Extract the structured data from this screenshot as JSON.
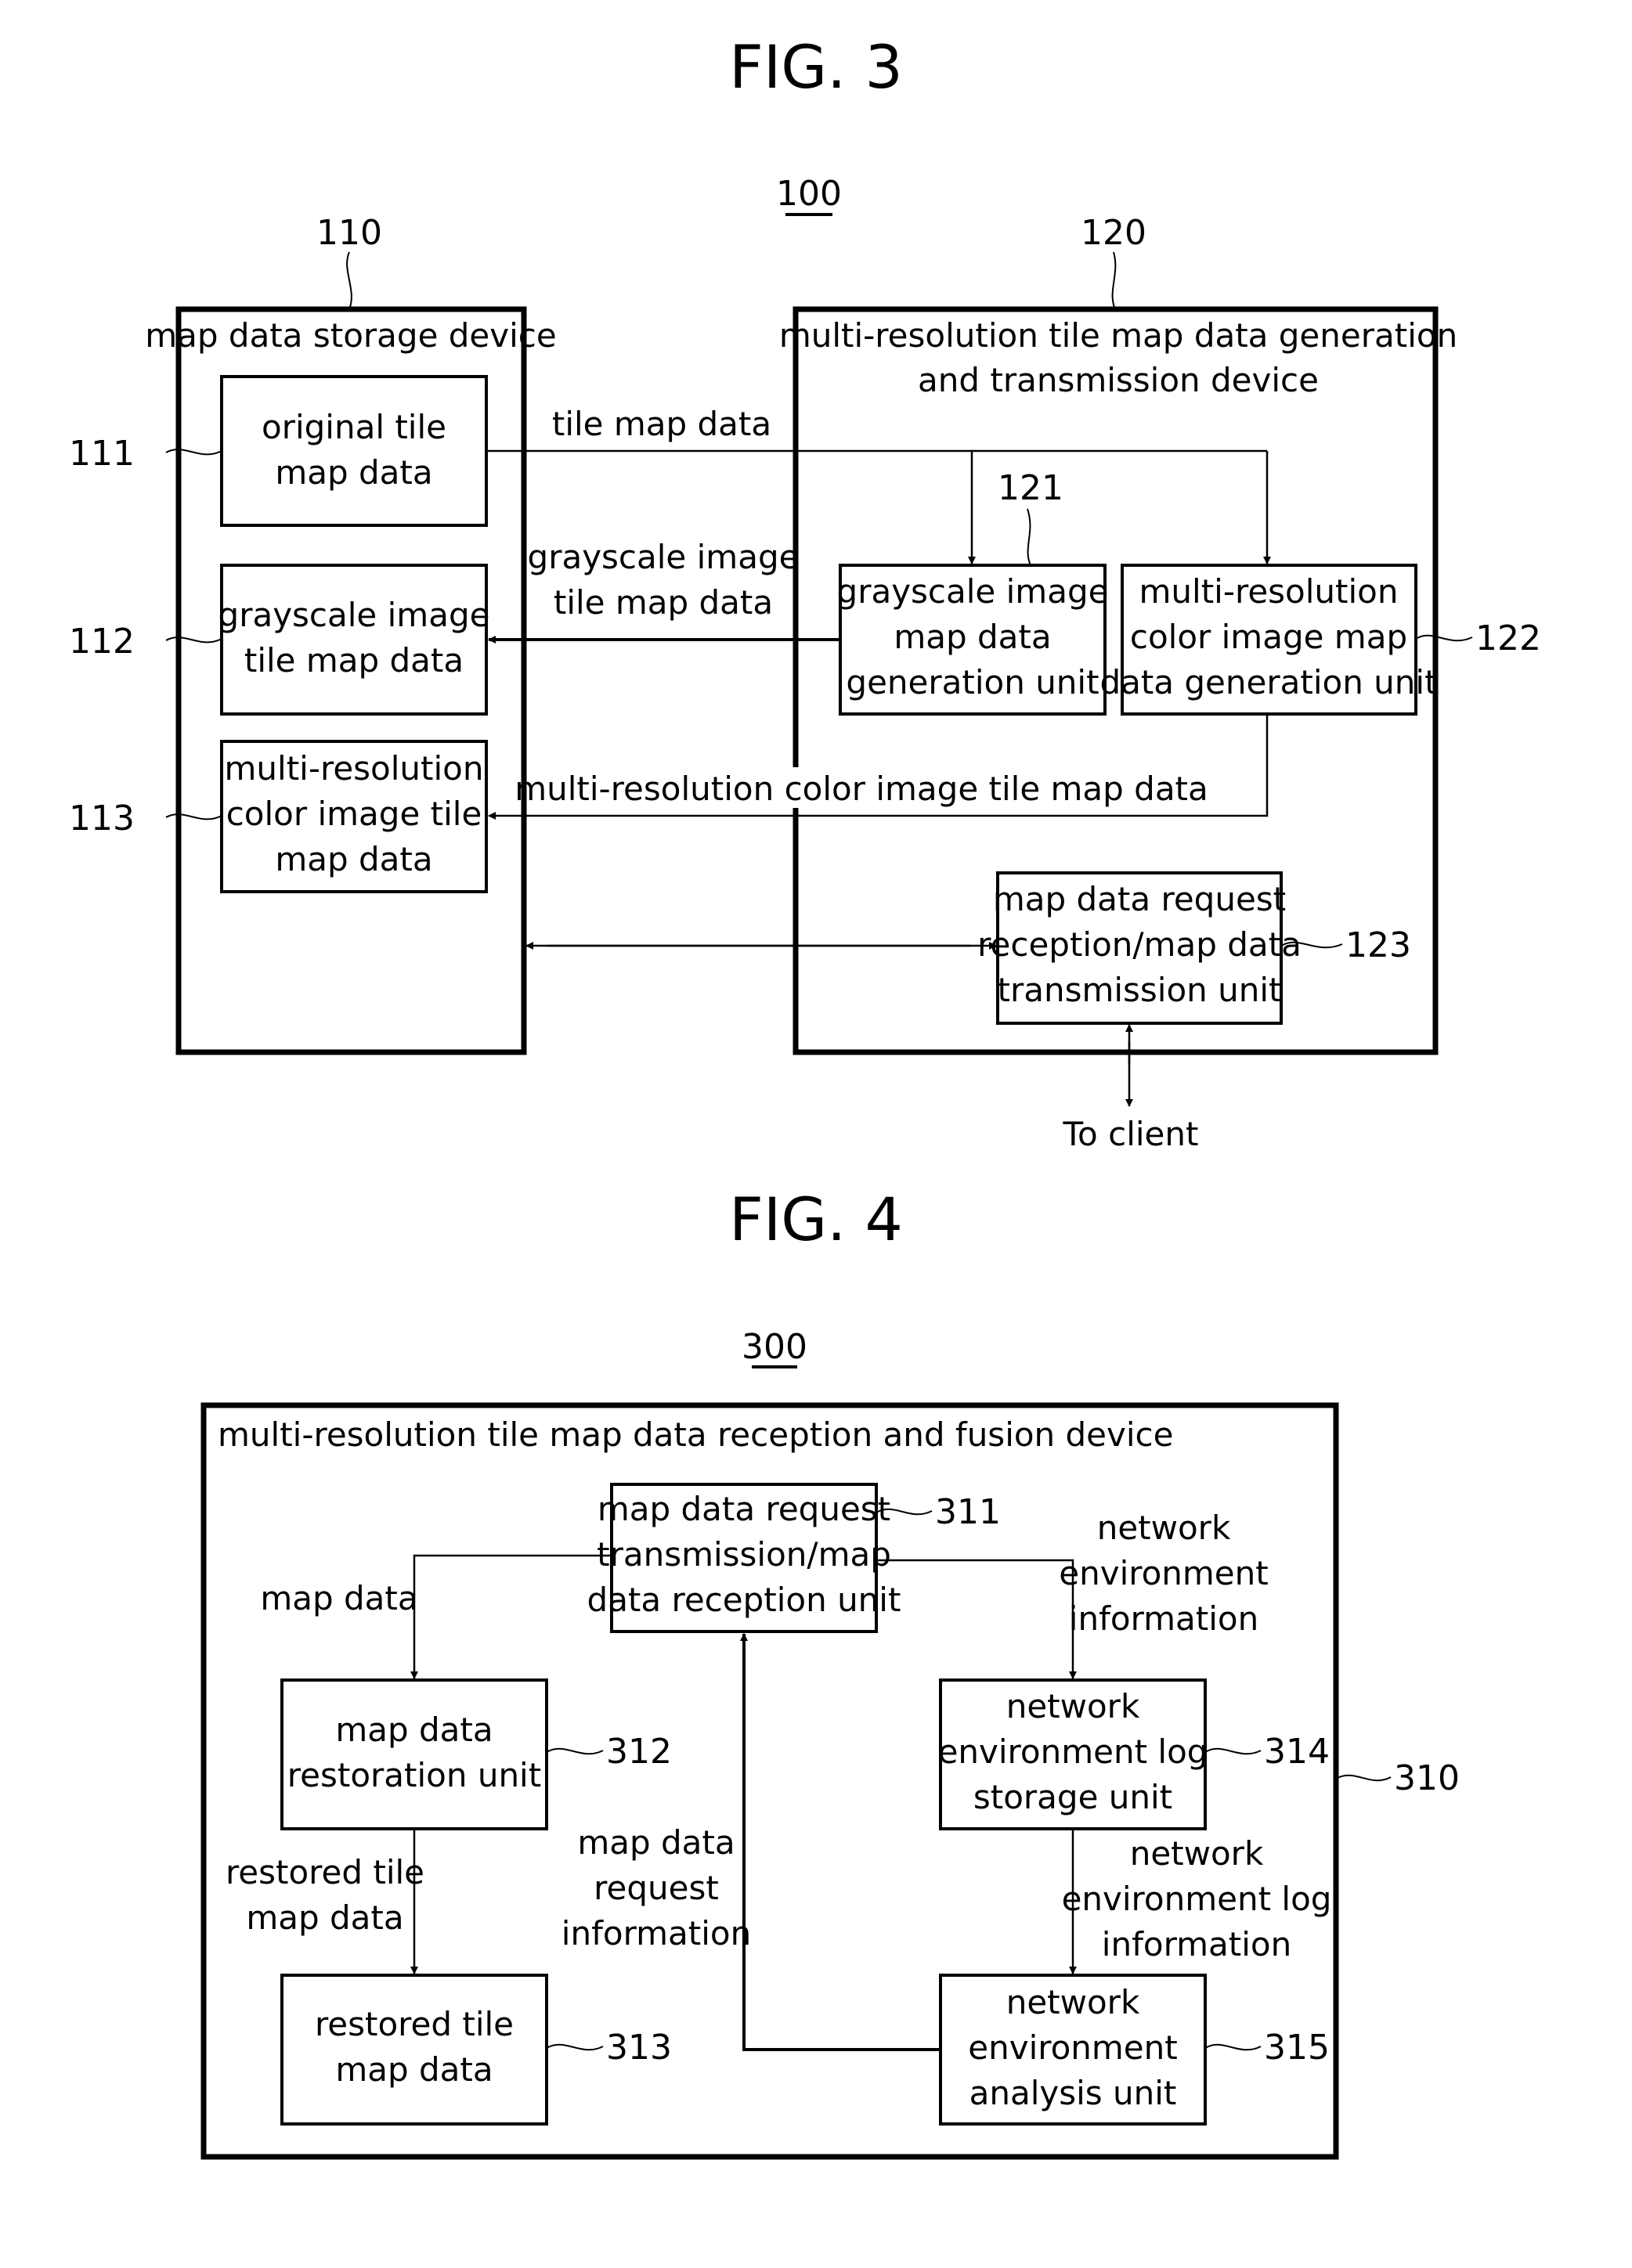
{
  "fig3": {
    "title": "FIG. 3",
    "system_ref": "100",
    "storage_device": {
      "ref": "110",
      "label": "map data storage device",
      "items": [
        {
          "ref": "111",
          "lines": [
            "original tile",
            "map data"
          ]
        },
        {
          "ref": "112",
          "lines": [
            "grayscale image",
            "tile map data"
          ]
        },
        {
          "ref": "113",
          "lines": [
            "multi-resolution",
            "color image tile",
            "map data"
          ]
        }
      ]
    },
    "generation_device": {
      "ref": "120",
      "label_lines": [
        "multi-resolution tile map data generation",
        "and transmission device"
      ],
      "units": [
        {
          "ref": "121",
          "lines": [
            "grayscale image",
            "map data",
            "generation unit"
          ]
        },
        {
          "ref": "122",
          "lines": [
            "multi-resolution",
            "color image map",
            "data generation unit"
          ]
        },
        {
          "ref": "123",
          "lines": [
            "map data request",
            "reception/map data",
            "transmission unit"
          ]
        }
      ]
    },
    "flows": {
      "tile_map_data": "tile map data",
      "grayscale_lines": [
        "grayscale image",
        "tile map data"
      ],
      "multires": "multi-resolution color image tile map data",
      "to_client": "To client"
    }
  },
  "fig4": {
    "title": "FIG. 4",
    "system_ref": "300",
    "device": {
      "ref": "310",
      "label": "multi-resolution tile map data reception and fusion device",
      "units": [
        {
          "ref": "311",
          "lines": [
            "map data request",
            "transmission/map",
            "data reception unit"
          ]
        },
        {
          "ref": "312",
          "lines": [
            "map data",
            "restoration unit"
          ]
        },
        {
          "ref": "313",
          "lines": [
            "restored tile",
            "map data"
          ]
        },
        {
          "ref": "314",
          "lines": [
            "network",
            "environment log",
            "storage unit"
          ]
        },
        {
          "ref": "315",
          "lines": [
            "network",
            "environment",
            "analysis unit"
          ]
        }
      ]
    },
    "flows": {
      "map_data": "map data",
      "restored_lines": [
        "restored tile",
        "map data"
      ],
      "request_info_lines": [
        "map data",
        "request",
        "information"
      ],
      "net_env_info_lines": [
        "network",
        "environment",
        "information"
      ],
      "net_env_log_lines": [
        "network",
        "environment log",
        "information"
      ]
    }
  }
}
